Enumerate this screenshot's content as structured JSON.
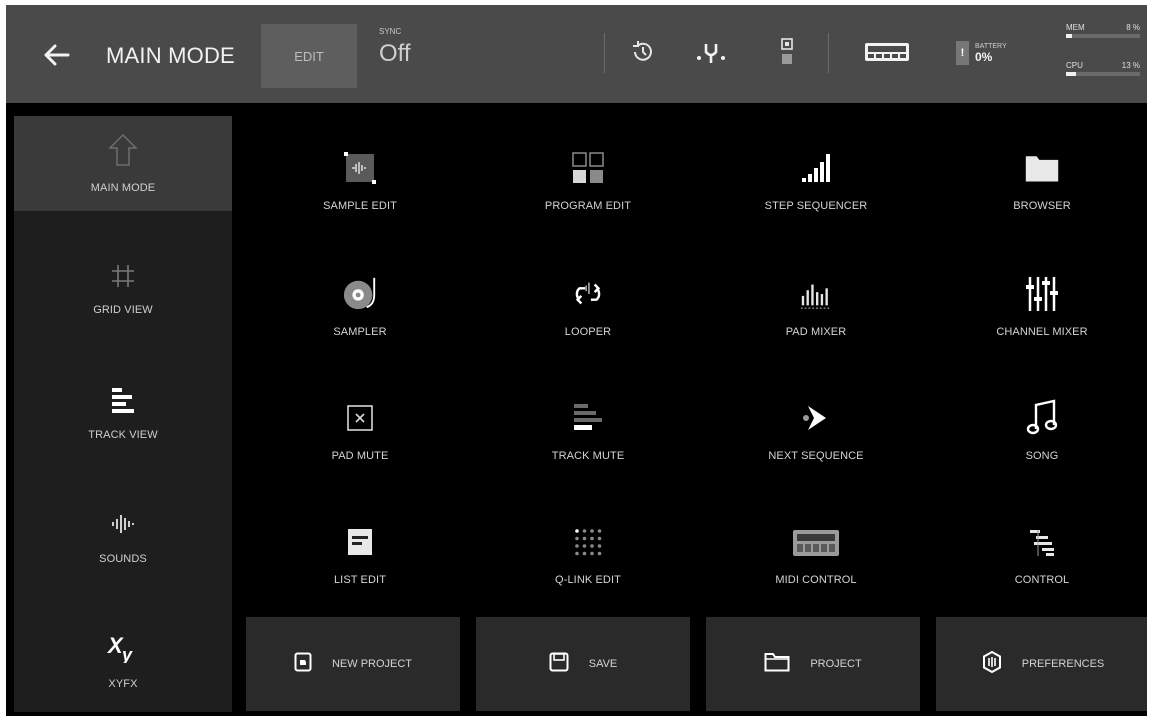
{
  "header": {
    "title": "MAIN MODE",
    "edit_label": "EDIT",
    "sync_label": "SYNC",
    "sync_value": "Off",
    "battery_label": "BATTERY",
    "battery_value": "0%",
    "battery_mark": "!",
    "mem_label": "MEM",
    "mem_value": "8 %",
    "mem_fraction": 0.08,
    "cpu_label": "CPU",
    "cpu_value": "13 %",
    "cpu_fraction": 0.13,
    "icons": [
      "back-arrow-icon",
      "history-icon",
      "tuning-fork-icon",
      "storage-icon",
      "mpc-device-icon",
      "battery-icon"
    ]
  },
  "sidebar": {
    "items": [
      {
        "label": "MAIN MODE",
        "icon": "home-arrow-icon",
        "active": true
      },
      {
        "label": "GRID VIEW",
        "icon": "grid-icon"
      },
      {
        "label": "TRACK VIEW",
        "icon": "track-bars-icon"
      },
      {
        "label": "SOUNDS",
        "icon": "waveform-icon"
      },
      {
        "label": "XYFX",
        "icon": "xy-icon"
      }
    ]
  },
  "grid": {
    "tiles": [
      {
        "label": "SAMPLE EDIT",
        "icon": "sample-edit-icon"
      },
      {
        "label": "PROGRAM EDIT",
        "icon": "program-edit-icon"
      },
      {
        "label": "STEP SEQUENCER",
        "icon": "step-sequencer-icon"
      },
      {
        "label": "BROWSER",
        "icon": "folder-icon"
      },
      {
        "label": "SAMPLER",
        "icon": "vinyl-icon"
      },
      {
        "label": "LOOPER",
        "icon": "loop-icon"
      },
      {
        "label": "PAD MIXER",
        "icon": "pad-mixer-icon"
      },
      {
        "label": "CHANNEL MIXER",
        "icon": "faders-icon"
      },
      {
        "label": "PAD MUTE",
        "icon": "mute-box-icon"
      },
      {
        "label": "TRACK MUTE",
        "icon": "track-mute-icon"
      },
      {
        "label": "NEXT SEQUENCE",
        "icon": "next-sequence-icon"
      },
      {
        "label": "SONG",
        "icon": "music-note-icon"
      },
      {
        "label": "LIST EDIT",
        "icon": "list-edit-icon"
      },
      {
        "label": "Q-LINK EDIT",
        "icon": "qlink-dots-icon"
      },
      {
        "label": "MIDI CONTROL",
        "icon": "midi-device-icon"
      },
      {
        "label": "CONTROL",
        "icon": "control-sliders-icon"
      }
    ]
  },
  "bottom": {
    "buttons": [
      {
        "label": "NEW PROJECT",
        "icon": "new-project-icon"
      },
      {
        "label": "SAVE",
        "icon": "save-icon"
      },
      {
        "label": "PROJECT",
        "icon": "project-folder-icon"
      },
      {
        "label": "PREFERENCES",
        "icon": "preferences-icon"
      }
    ]
  },
  "colors": {
    "header_bg": "#4a4a4a",
    "main_bg": "#000000",
    "sidebar_bg": "#1e1e1e",
    "active_bg": "#3a3a3a",
    "button_bg": "#2a2a2a"
  }
}
